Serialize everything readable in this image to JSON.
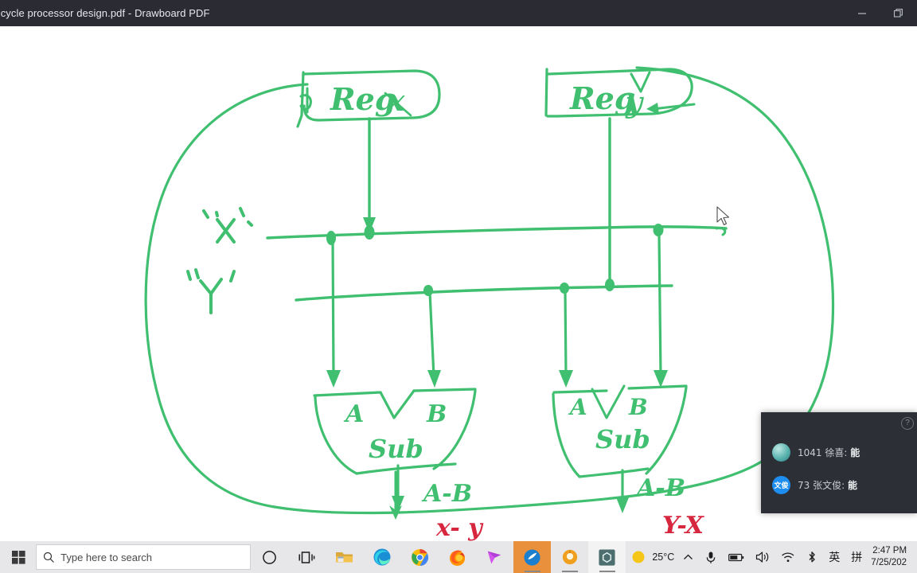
{
  "window": {
    "title": "ticycle processor design.pdf - Drawboard PDF",
    "minimize_label": "minimize",
    "maximize_label": "restore"
  },
  "document": {
    "annotations": {
      "reg_x_label": "Reg x",
      "reg_y_label": "Reg y",
      "bus_label_x": "x",
      "bus_label_y": "y",
      "left_alu": {
        "input_a": "A",
        "input_b": "B",
        "operation": "Sub",
        "output_green": "A-B",
        "output_red": "x- y"
      },
      "right_alu": {
        "input_a": "A",
        "input_b": "B",
        "operation": "Sub",
        "output_green": "A-B",
        "output_red": "Y-X"
      }
    },
    "ink_color": "#3fbf6f",
    "ink_color_red": "#d6273f"
  },
  "chat_overlay": {
    "help_glyph": "?",
    "messages": [
      {
        "avatar_text": "",
        "text": "1041 徐喜: ",
        "highlight": "能"
      },
      {
        "avatar_text": "文俊",
        "text": "73 张文俊: ",
        "highlight": "能"
      }
    ]
  },
  "taskbar": {
    "search_placeholder": "Type here to search",
    "search_icon": "search-icon",
    "items": [
      {
        "name": "cortana-icon",
        "label": "Cortana"
      },
      {
        "name": "task-view-icon",
        "label": "Task View"
      },
      {
        "name": "file-explorer-icon",
        "label": "File Explorer"
      },
      {
        "name": "microsoft-edge-icon",
        "label": "Microsoft Edge"
      },
      {
        "name": "google-chrome-icon",
        "label": "Google Chrome"
      },
      {
        "name": "firefox-icon",
        "label": "Firefox"
      },
      {
        "name": "cursor-app-icon",
        "label": "Cursor"
      },
      {
        "name": "drawboard-pdf-icon",
        "label": "Drawboard PDF"
      },
      {
        "name": "orange-app-icon",
        "label": "App"
      },
      {
        "name": "hexagon-app-icon",
        "label": "App"
      }
    ],
    "tray": {
      "weather_temp": "25°C",
      "show_hidden_icons": "^",
      "microphone": "microphone-icon",
      "battery": "battery-icon",
      "volume": "volume-icon",
      "network": "wifi-icon",
      "bluetooth": "bluetooth-icon",
      "ime_lang": "英",
      "ime_mode": "拼",
      "time": "2:47 PM",
      "date": "7/25/202"
    }
  }
}
